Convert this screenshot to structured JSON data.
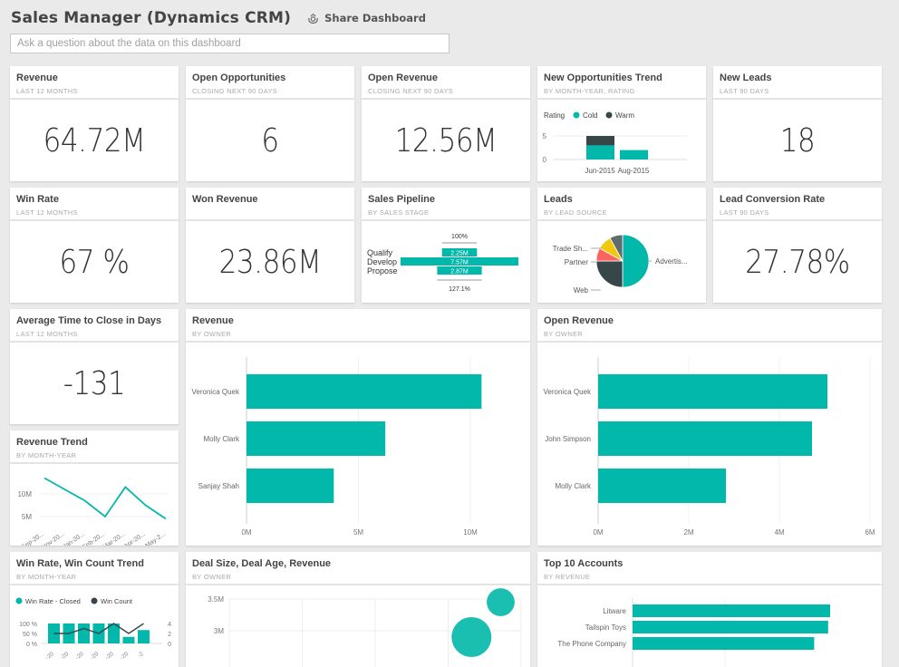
{
  "header": {
    "title": "Sales Manager (Dynamics CRM)",
    "share_label": "Share Dashboard",
    "qa_placeholder": "Ask a question about the data on this dashboard"
  },
  "colors": {
    "teal": "#01b8aa",
    "dark": "#374649",
    "red": "#fd625e",
    "yellow": "#f2c80f",
    "gray": "#5f6b6d"
  },
  "tiles": {
    "revenue": {
      "title": "Revenue",
      "subtitle": "LAST 12 MONTHS",
      "value": "64.72M"
    },
    "open_opps": {
      "title": "Open Opportunities",
      "subtitle": "CLOSING NEXT 90 DAYS",
      "value": "6"
    },
    "open_revenue": {
      "title": "Open Revenue",
      "subtitle": "CLOSING NEXT 90 DAYS",
      "value": "12.56M"
    },
    "new_opps_trend": {
      "title": "New Opportunities Trend",
      "subtitle": "BY MONTH-YEAR, RATING"
    },
    "new_leads": {
      "title": "New Leads",
      "subtitle": "LAST 90 DAYS",
      "value": "18"
    },
    "win_rate": {
      "title": "Win Rate",
      "subtitle": "LAST 12 MONTHS",
      "value": "67 %"
    },
    "won_revenue": {
      "title": "Won Revenue",
      "subtitle": "",
      "value": "23.86M"
    },
    "sales_pipeline": {
      "title": "Sales Pipeline",
      "subtitle": "BY SALES STAGE"
    },
    "leads": {
      "title": "Leads",
      "subtitle": "BY LEAD SOURCE"
    },
    "lead_conversion": {
      "title": "Lead Conversion Rate",
      "subtitle": "LAST 90 DAYS",
      "value": "27.78%"
    },
    "avg_time_close": {
      "title": "Average Time to Close in Days",
      "subtitle": "LAST 12 MONTHS",
      "value": "-131"
    },
    "revenue_by_owner": {
      "title": "Revenue",
      "subtitle": "BY OWNER"
    },
    "open_revenue_by_owner": {
      "title": "Open Revenue",
      "subtitle": "BY OWNER"
    },
    "revenue_trend": {
      "title": "Revenue Trend",
      "subtitle": "BY MONTH-YEAR"
    },
    "win_trend": {
      "title": "Win Rate, Win Count Trend",
      "subtitle": "BY MONTH-YEAR"
    },
    "deal_size": {
      "title": "Deal Size, Deal Age, Revenue",
      "subtitle": "BY OWNER"
    },
    "top_accounts": {
      "title": "Top 10 Accounts",
      "subtitle": "BY REVENUE"
    }
  },
  "chart_data": [
    {
      "id": "new_opps_trend",
      "type": "bar",
      "stacked": true,
      "legend_title": "Rating",
      "categories": [
        "Jun-2015",
        "Aug-2015"
      ],
      "series": [
        {
          "name": "Cold",
          "values": [
            3,
            2
          ]
        },
        {
          "name": "Warm",
          "values": [
            2,
            0
          ]
        }
      ],
      "yticks": [
        "0",
        "5"
      ],
      "ylim": [
        0,
        5
      ]
    },
    {
      "id": "sales_pipeline",
      "type": "funnel",
      "categories": [
        "Qualify",
        "Develop",
        "Propose"
      ],
      "values": [
        2.25,
        7.57,
        2.87
      ],
      "value_labels": [
        "2.25M",
        "7.57M",
        "2.87M"
      ],
      "top_label": "100%",
      "bottom_label": "127.1%"
    },
    {
      "id": "leads",
      "type": "pie",
      "labels": [
        "Advertis...",
        "Web",
        "Partner",
        "Trade Sh...",
        ""
      ],
      "values": [
        50,
        25,
        8,
        9,
        8
      ]
    },
    {
      "id": "revenue_by_owner",
      "type": "bar",
      "orientation": "horizontal",
      "categories": [
        "Veronica Quek",
        "Molly Clark",
        "Sanjay Shah"
      ],
      "values": [
        10.5,
        6.2,
        3.9
      ],
      "xticks": [
        "0M",
        "5M",
        "10M"
      ],
      "xlim": [
        0,
        12
      ]
    },
    {
      "id": "open_revenue_by_owner",
      "type": "bar",
      "orientation": "horizontal",
      "categories": [
        "Veronica Quek",
        "John Simpson",
        "Molly Clark"
      ],
      "values": [
        5.06,
        4.72,
        2.82
      ],
      "xticks": [
        "0M",
        "2M",
        "4M",
        "6M"
      ],
      "xlim": [
        0,
        6
      ]
    },
    {
      "id": "revenue_trend",
      "type": "line",
      "categories": [
        "Sep-20...",
        "Nov-20...",
        "Jan-20...",
        "Feb-20...",
        "Mar-20...",
        "Apr-20...",
        "May-2..."
      ],
      "values": [
        13.5,
        11.0,
        8.5,
        5.0,
        11.5,
        7.5,
        4.5
      ],
      "yticks": [
        "5M",
        "10M"
      ],
      "ylim": [
        3,
        15
      ]
    },
    {
      "id": "win_trend",
      "type": "combo",
      "legend": [
        "Win Rate - Closed",
        "Win Count"
      ],
      "categories": [
        "-20",
        "-20",
        "-20",
        "-20",
        "-20",
        "-20",
        "-2"
      ],
      "bar_values": [
        100,
        100,
        100,
        100,
        100,
        33,
        67
      ],
      "line_values": [
        2,
        2,
        3,
        2,
        4,
        2,
        4
      ],
      "yticks_left": [
        "0 %",
        "50 %",
        "100 %"
      ],
      "yticks_right": [
        "0",
        "2",
        "4"
      ]
    },
    {
      "id": "deal_size",
      "type": "scatter",
      "yticks": [
        "3M",
        "3.5M"
      ],
      "points": [
        {
          "x": 0.83,
          "y": 2.9,
          "size": 1.0
        },
        {
          "x": 0.93,
          "y": 3.45,
          "size": 0.7
        }
      ]
    },
    {
      "id": "top_accounts",
      "type": "bar",
      "orientation": "horizontal",
      "categories": [
        "Litware",
        "Tailspin Toys",
        "The Phone Company"
      ],
      "values": [
        100,
        99,
        92
      ]
    }
  ]
}
